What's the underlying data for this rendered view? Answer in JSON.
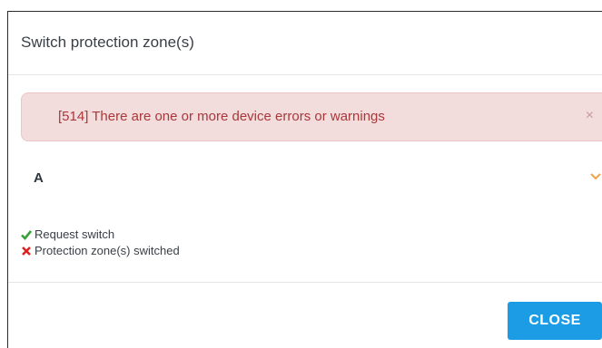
{
  "dialog": {
    "title": "Switch protection zone(s)"
  },
  "alert": {
    "message": "[514] There are one or more device errors or warnings",
    "close_glyph": "×",
    "background_color": "#f2dcdc",
    "text_color": "#a8383b"
  },
  "zone": {
    "label": "A",
    "chevron_icon": "chevron-down-icon",
    "chevron_color": "#f0a24a"
  },
  "status": {
    "items": [
      {
        "label": "Request switch",
        "state": "success",
        "icon": "check-icon",
        "color": "#3aa03a"
      },
      {
        "label": "Protection zone(s) switched",
        "state": "failed",
        "icon": "cross-icon",
        "color": "#e02020"
      }
    ]
  },
  "footer": {
    "close_label": "CLOSE",
    "accent_color": "#1d9ce6"
  }
}
